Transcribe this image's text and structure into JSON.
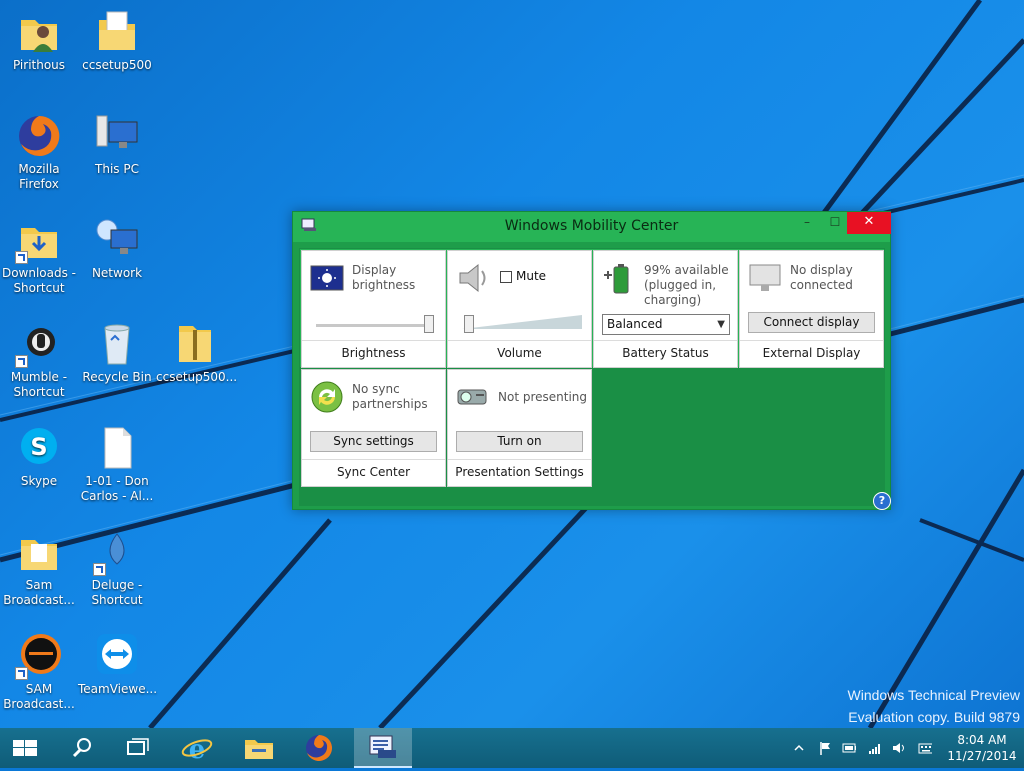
{
  "desktop": {
    "icons": [
      {
        "label": "Pirithous"
      },
      {
        "label": "ccsetup500"
      },
      {
        "label": "Mozilla Firefox"
      },
      {
        "label": "This PC"
      },
      {
        "label": "Downloads - Shortcut"
      },
      {
        "label": "Network"
      },
      {
        "label": "Mumble - Shortcut"
      },
      {
        "label": "Recycle Bin"
      },
      {
        "label": "ccsetup500..."
      },
      {
        "label": "Skype"
      },
      {
        "label": "1-01 - Don Carlos - Al..."
      },
      {
        "label": "Sam Broadcast..."
      },
      {
        "label": "Deluge - Shortcut"
      },
      {
        "label": "SAM Broadcast..."
      },
      {
        "label": "TeamViewe..."
      }
    ],
    "watermark": {
      "line1": "Windows Technical Preview",
      "line2": "Evaluation copy. Build 9879"
    }
  },
  "window": {
    "title": "Windows Mobility Center",
    "controls": {
      "minimize": "–",
      "maximize": "☐",
      "close": "✕"
    },
    "tiles": {
      "brightness": {
        "desc": "Display brightness",
        "footer": "Brightness",
        "level": 0.96
      },
      "volume": {
        "mute_label": "Mute",
        "footer": "Volume",
        "level": 0.03
      },
      "battery": {
        "desc": "99% available (plugged in, charging)",
        "plan": "Balanced",
        "footer": "Battery Status"
      },
      "external_display": {
        "desc": "No display connected",
        "button": "Connect display",
        "footer": "External Display"
      },
      "sync": {
        "desc": "No sync partnerships",
        "button": "Sync settings",
        "footer": "Sync Center"
      },
      "presentation": {
        "desc": "Not presenting",
        "button": "Turn on",
        "footer": "Presentation Settings"
      }
    },
    "help": "?"
  },
  "taskbar": {
    "clock": {
      "time": "8:04 AM",
      "date": "11/27/2014"
    }
  },
  "colors": {
    "wmc_green": "#27b456",
    "wmc_dark_green": "#1a8f45",
    "close_red": "#e81123",
    "taskbar": "#0f5c78",
    "desktop_blue": "#1387e6"
  }
}
